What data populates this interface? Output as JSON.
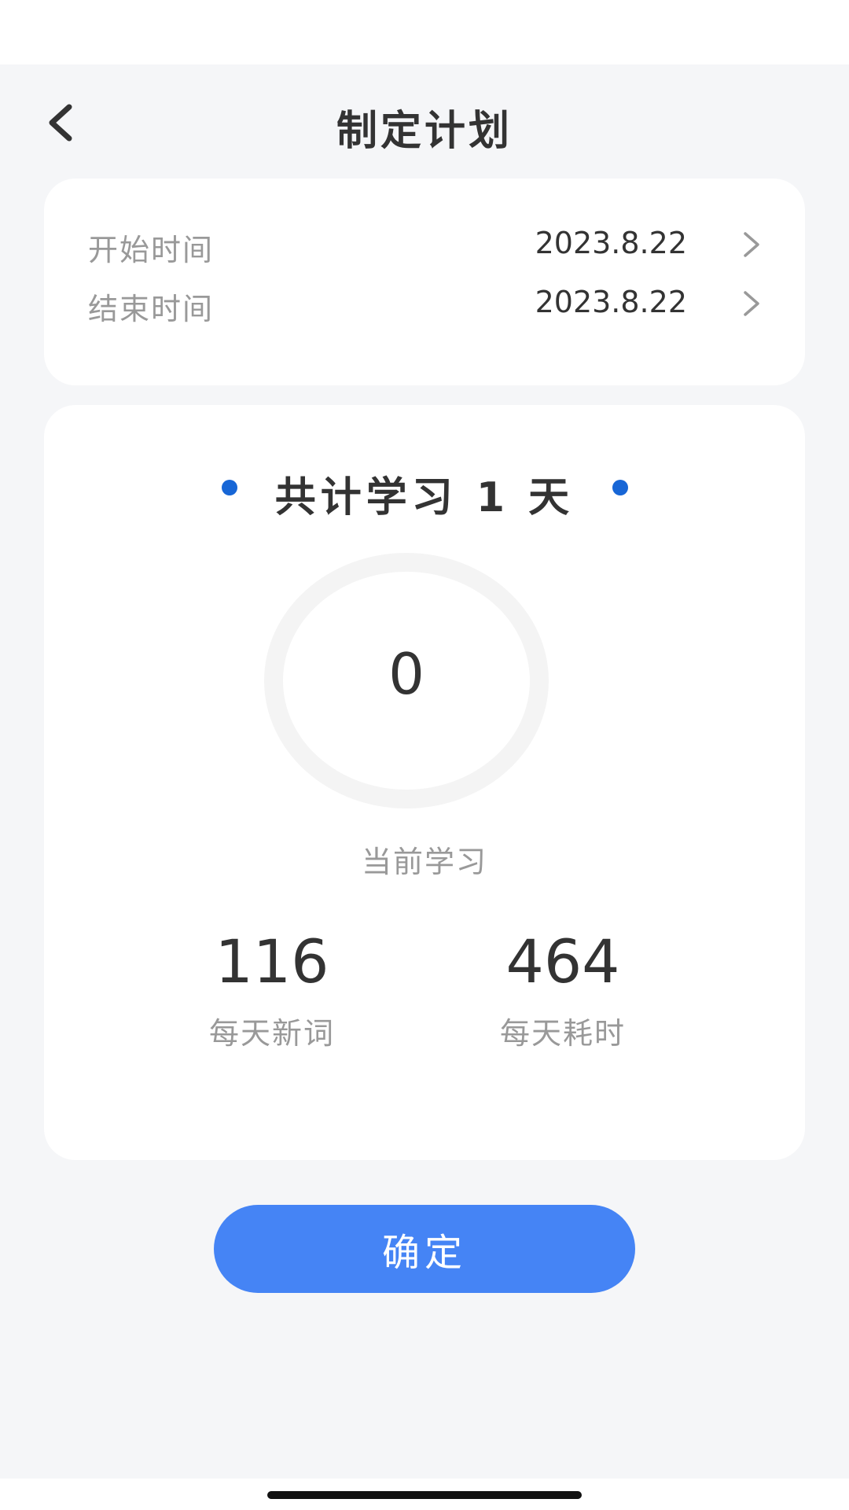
{
  "nav": {
    "title": "制定计划",
    "back_icon": "chevron-left-icon"
  },
  "dates": {
    "start": {
      "label": "开始时间",
      "value": "2023.8.22"
    },
    "end": {
      "label": "结束时间",
      "value": "2023.8.22"
    },
    "chevron_icon": "chevron-right-icon"
  },
  "summary": {
    "total_text": "共计学习 1 天",
    "accent_color": "#1766d6",
    "ring_value": "0",
    "ring_label": "当前学习",
    "daily_new_words": {
      "value": "116",
      "label": "每天新词"
    },
    "daily_time": {
      "value": "464",
      "label": "每天耗时"
    }
  },
  "confirm": {
    "label": "确定",
    "color": "#4584f5"
  }
}
